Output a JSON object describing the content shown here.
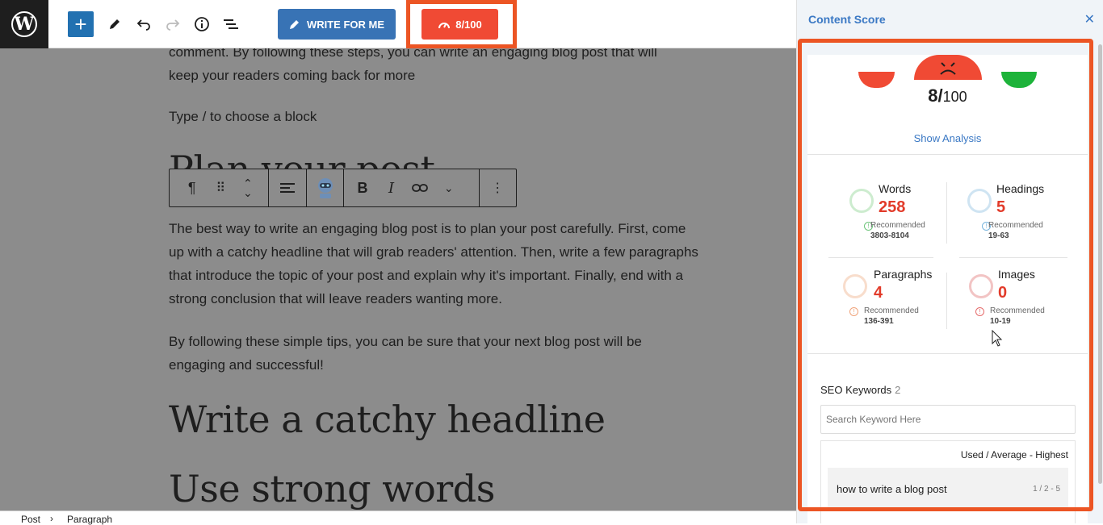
{
  "toolbar": {
    "write_for_me": "WRITE FOR ME",
    "score": "8/100"
  },
  "editor": {
    "intro_line1": "comment. By following these steps, you can write an engaging blog post that will",
    "intro_line2": "keep your readers coming back for more",
    "placeholder": "Type / to choose a block",
    "hidden_heading": "Plan your post",
    "paragraph1": "The best way to write an engaging blog post is to plan your post carefully. First, come up with a catchy headline that will grab readers' attention. Then, write a few paragraphs that introduce the topic of your post and explain why it's important. Finally, end with a strong conclusion that will leave readers wanting more.",
    "paragraph2": "By following these simple tips, you can be sure that your next blog post will be engaging and successful!",
    "heading2": "Write a catchy headline",
    "heading3": "Use strong words"
  },
  "breadcrumb": {
    "item1": "Post",
    "separator": "›",
    "item2": "Paragraph"
  },
  "sidebar": {
    "title": "Content Score",
    "score_value": "8/",
    "score_total": "100",
    "show_analysis": "Show Analysis",
    "metrics": [
      {
        "label": "Words",
        "value": "258",
        "rec_label": "Recommended",
        "rec": "3803-8104"
      },
      {
        "label": "Headings",
        "value": "5",
        "rec_label": "Recommended",
        "rec": "19-63"
      },
      {
        "label": "Paragraphs",
        "value": "4",
        "rec_label": "Recommended",
        "rec": "136-391"
      },
      {
        "label": "Images",
        "value": "0",
        "rec_label": "Recommended",
        "rec": "10-19"
      }
    ],
    "seo_title": "SEO Keywords",
    "seo_count": "2",
    "search_placeholder": "Search Keyword Here",
    "kw_header": "Used / Average - Highest",
    "keywords": [
      {
        "text": "how to write a blog post",
        "stat": "1 / 2 - 5"
      }
    ]
  },
  "colors": {
    "accent_blue": "#3873b5",
    "score_red": "#f04a34",
    "highlight": "#ec5524",
    "good_green": "#1db33a"
  }
}
